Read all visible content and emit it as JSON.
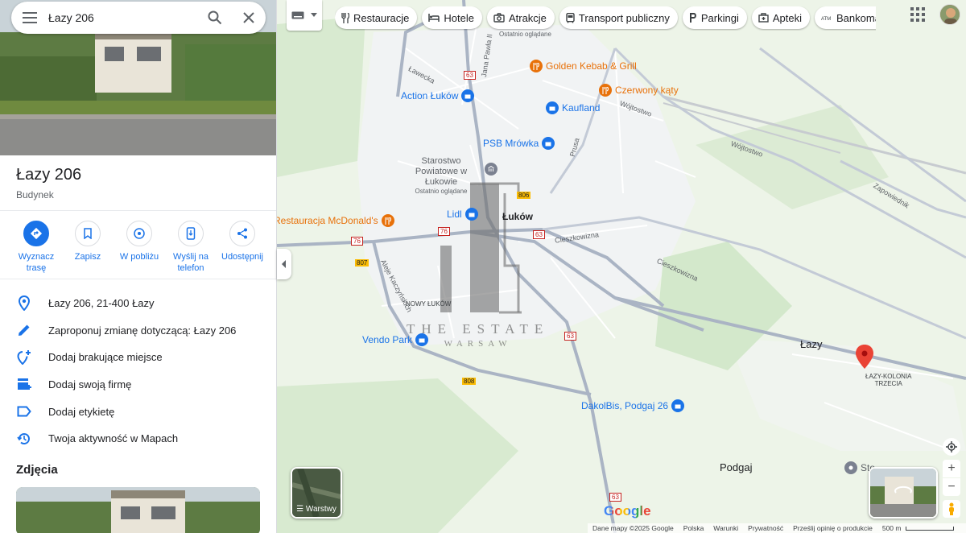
{
  "search": {
    "query": "Łazy 206"
  },
  "place": {
    "title": "Łazy 206",
    "type": "Budynek"
  },
  "actions": [
    {
      "label": "Wyznacz trasę",
      "icon": "directions-icon"
    },
    {
      "label": "Zapisz",
      "icon": "bookmark-icon"
    },
    {
      "label": "W pobliżu",
      "icon": "nearby-icon"
    },
    {
      "label": "Wyślij na telefon",
      "icon": "send-to-phone-icon"
    },
    {
      "label": "Udostępnij",
      "icon": "share-icon"
    }
  ],
  "info": [
    {
      "text": "Łazy 206, 21-400 Łazy",
      "icon": "location-pin-icon"
    },
    {
      "text": "Zaproponuj zmianę dotyczącą: Łazy 206",
      "icon": "edit-pencil-icon"
    },
    {
      "text": "Dodaj brakujące miejsce",
      "icon": "add-place-icon"
    },
    {
      "text": "Dodaj swoją firmę",
      "icon": "add-business-icon"
    },
    {
      "text": "Dodaj etykietę",
      "icon": "label-icon"
    },
    {
      "text": "Twoja aktywność w Mapach",
      "icon": "history-icon"
    }
  ],
  "photos_heading": "Zdjęcia",
  "chips": [
    {
      "label": "Restauracje",
      "icon": "fork-knife-icon"
    },
    {
      "label": "Hotele",
      "icon": "bed-icon"
    },
    {
      "label": "Atrakcje",
      "icon": "camera-icon"
    },
    {
      "label": "Transport publiczny",
      "icon": "bus-icon"
    },
    {
      "label": "Parkingi",
      "icon": "parking-icon"
    },
    {
      "label": "Apteki",
      "icon": "pharmacy-icon"
    },
    {
      "label": "Bankomaty",
      "icon": "atm-icon"
    }
  ],
  "map": {
    "places": {
      "town": "Łuków",
      "lazy": "Łazy",
      "lazy_kolonia": "ŁAZY-KOLONIA\nTRZECIA",
      "podgaj": "Podgaj",
      "nowy_lukow": "NOWY ŁUKÓW",
      "ostatnio": "Ostatnio oglądane"
    },
    "streets": {
      "lawecka": "Ławecka",
      "jana_pawla": "Jana Pawła II",
      "wojtostwo1": "Wójtostwo",
      "wojtostwo2": "Wójtostwo",
      "zapowiednik": "Zapowiednik",
      "cieszkowizna1": "Cieszkowizna",
      "cieszkowizna2": "Cieszkowizna",
      "prusa": "Prusa",
      "aleja": "Aleje Kaczyńskich"
    },
    "road_numbers": [
      "63",
      "806",
      "76",
      "76",
      "807",
      "63",
      "808",
      "63",
      "63"
    ],
    "pois": [
      {
        "name": "Golden Kebab & Grill",
        "type": "restaurant",
        "color": "#e8710a"
      },
      {
        "name": "Czerwony kąty",
        "type": "restaurant",
        "color": "#e8710a"
      },
      {
        "name": "Kaufland",
        "type": "shopping",
        "color": "#1a73e8"
      },
      {
        "name": "Action Łuków",
        "type": "shopping",
        "color": "#1a73e8"
      },
      {
        "name": "PSB Mrówka",
        "type": "shopping",
        "color": "#1a73e8"
      },
      {
        "name": "Starostwo Powiatowe w Łukowie",
        "type": "government",
        "color": "#5f6368"
      },
      {
        "name": "Ostatnio oglądane",
        "type": "note",
        "color": "#5f6368"
      },
      {
        "name": "Lidl",
        "type": "shopping",
        "color": "#1a73e8"
      },
      {
        "name": "Restauracja McDonald's",
        "type": "restaurant",
        "color": "#e8710a"
      },
      {
        "name": "Vendo Park",
        "type": "shopping",
        "color": "#1a73e8"
      },
      {
        "name": "DakolBis, Podgaj 26",
        "type": "shopping",
        "color": "#1a73e8"
      },
      {
        "name": "Sto...",
        "type": "place",
        "color": "#5f6368"
      }
    ],
    "watermark": {
      "line1": "THE ESTATE",
      "line2": "WARSAW"
    },
    "layers_label": "Warstwy",
    "google": "Google",
    "footer": [
      "Dane mapy ©2025 Google",
      "Polska",
      "Warunki",
      "Prywatność",
      "Prześlij opinię o produkcie",
      "500 m"
    ],
    "marker_color": "#ea4335"
  }
}
